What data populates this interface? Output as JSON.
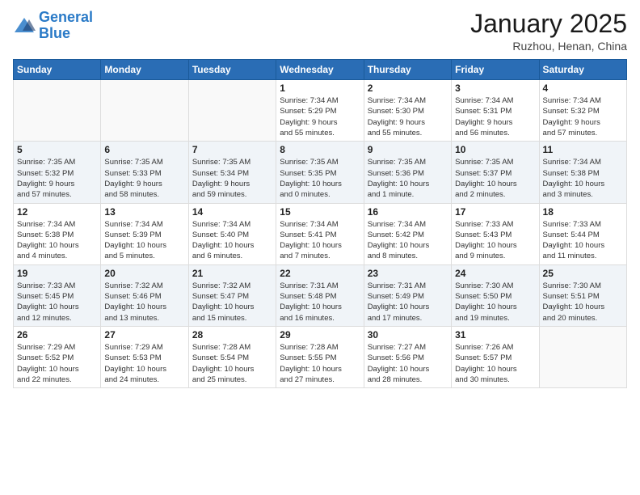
{
  "header": {
    "logo_line1": "General",
    "logo_line2": "Blue",
    "month": "January 2025",
    "location": "Ruzhou, Henan, China"
  },
  "days_of_week": [
    "Sunday",
    "Monday",
    "Tuesday",
    "Wednesday",
    "Thursday",
    "Friday",
    "Saturday"
  ],
  "weeks": [
    {
      "shaded": false,
      "days": [
        {
          "num": "",
          "info": ""
        },
        {
          "num": "",
          "info": ""
        },
        {
          "num": "",
          "info": ""
        },
        {
          "num": "1",
          "info": "Sunrise: 7:34 AM\nSunset: 5:29 PM\nDaylight: 9 hours\nand 55 minutes."
        },
        {
          "num": "2",
          "info": "Sunrise: 7:34 AM\nSunset: 5:30 PM\nDaylight: 9 hours\nand 55 minutes."
        },
        {
          "num": "3",
          "info": "Sunrise: 7:34 AM\nSunset: 5:31 PM\nDaylight: 9 hours\nand 56 minutes."
        },
        {
          "num": "4",
          "info": "Sunrise: 7:34 AM\nSunset: 5:32 PM\nDaylight: 9 hours\nand 57 minutes."
        }
      ]
    },
    {
      "shaded": true,
      "days": [
        {
          "num": "5",
          "info": "Sunrise: 7:35 AM\nSunset: 5:32 PM\nDaylight: 9 hours\nand 57 minutes."
        },
        {
          "num": "6",
          "info": "Sunrise: 7:35 AM\nSunset: 5:33 PM\nDaylight: 9 hours\nand 58 minutes."
        },
        {
          "num": "7",
          "info": "Sunrise: 7:35 AM\nSunset: 5:34 PM\nDaylight: 9 hours\nand 59 minutes."
        },
        {
          "num": "8",
          "info": "Sunrise: 7:35 AM\nSunset: 5:35 PM\nDaylight: 10 hours\nand 0 minutes."
        },
        {
          "num": "9",
          "info": "Sunrise: 7:35 AM\nSunset: 5:36 PM\nDaylight: 10 hours\nand 1 minute."
        },
        {
          "num": "10",
          "info": "Sunrise: 7:35 AM\nSunset: 5:37 PM\nDaylight: 10 hours\nand 2 minutes."
        },
        {
          "num": "11",
          "info": "Sunrise: 7:34 AM\nSunset: 5:38 PM\nDaylight: 10 hours\nand 3 minutes."
        }
      ]
    },
    {
      "shaded": false,
      "days": [
        {
          "num": "12",
          "info": "Sunrise: 7:34 AM\nSunset: 5:38 PM\nDaylight: 10 hours\nand 4 minutes."
        },
        {
          "num": "13",
          "info": "Sunrise: 7:34 AM\nSunset: 5:39 PM\nDaylight: 10 hours\nand 5 minutes."
        },
        {
          "num": "14",
          "info": "Sunrise: 7:34 AM\nSunset: 5:40 PM\nDaylight: 10 hours\nand 6 minutes."
        },
        {
          "num": "15",
          "info": "Sunrise: 7:34 AM\nSunset: 5:41 PM\nDaylight: 10 hours\nand 7 minutes."
        },
        {
          "num": "16",
          "info": "Sunrise: 7:34 AM\nSunset: 5:42 PM\nDaylight: 10 hours\nand 8 minutes."
        },
        {
          "num": "17",
          "info": "Sunrise: 7:33 AM\nSunset: 5:43 PM\nDaylight: 10 hours\nand 9 minutes."
        },
        {
          "num": "18",
          "info": "Sunrise: 7:33 AM\nSunset: 5:44 PM\nDaylight: 10 hours\nand 11 minutes."
        }
      ]
    },
    {
      "shaded": true,
      "days": [
        {
          "num": "19",
          "info": "Sunrise: 7:33 AM\nSunset: 5:45 PM\nDaylight: 10 hours\nand 12 minutes."
        },
        {
          "num": "20",
          "info": "Sunrise: 7:32 AM\nSunset: 5:46 PM\nDaylight: 10 hours\nand 13 minutes."
        },
        {
          "num": "21",
          "info": "Sunrise: 7:32 AM\nSunset: 5:47 PM\nDaylight: 10 hours\nand 15 minutes."
        },
        {
          "num": "22",
          "info": "Sunrise: 7:31 AM\nSunset: 5:48 PM\nDaylight: 10 hours\nand 16 minutes."
        },
        {
          "num": "23",
          "info": "Sunrise: 7:31 AM\nSunset: 5:49 PM\nDaylight: 10 hours\nand 17 minutes."
        },
        {
          "num": "24",
          "info": "Sunrise: 7:30 AM\nSunset: 5:50 PM\nDaylight: 10 hours\nand 19 minutes."
        },
        {
          "num": "25",
          "info": "Sunrise: 7:30 AM\nSunset: 5:51 PM\nDaylight: 10 hours\nand 20 minutes."
        }
      ]
    },
    {
      "shaded": false,
      "days": [
        {
          "num": "26",
          "info": "Sunrise: 7:29 AM\nSunset: 5:52 PM\nDaylight: 10 hours\nand 22 minutes."
        },
        {
          "num": "27",
          "info": "Sunrise: 7:29 AM\nSunset: 5:53 PM\nDaylight: 10 hours\nand 24 minutes."
        },
        {
          "num": "28",
          "info": "Sunrise: 7:28 AM\nSunset: 5:54 PM\nDaylight: 10 hours\nand 25 minutes."
        },
        {
          "num": "29",
          "info": "Sunrise: 7:28 AM\nSunset: 5:55 PM\nDaylight: 10 hours\nand 27 minutes."
        },
        {
          "num": "30",
          "info": "Sunrise: 7:27 AM\nSunset: 5:56 PM\nDaylight: 10 hours\nand 28 minutes."
        },
        {
          "num": "31",
          "info": "Sunrise: 7:26 AM\nSunset: 5:57 PM\nDaylight: 10 hours\nand 30 minutes."
        },
        {
          "num": "",
          "info": ""
        }
      ]
    }
  ]
}
